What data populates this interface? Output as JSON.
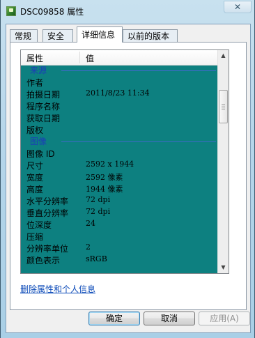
{
  "window": {
    "title": "DSC09858 属性",
    "close_glyph": "✕"
  },
  "tabs": [
    {
      "label": "常规",
      "active": false
    },
    {
      "label": "安全",
      "active": false
    },
    {
      "label": "详细信息",
      "active": true
    },
    {
      "label": "以前的版本",
      "active": false
    }
  ],
  "list": {
    "col_property": "属性",
    "col_value": "值",
    "rows": [
      {
        "type": "group",
        "label": "来源"
      },
      {
        "type": "prop",
        "key": "作者",
        "value": ""
      },
      {
        "type": "prop",
        "key": "拍摄日期",
        "value": "2011/8/23 11:34"
      },
      {
        "type": "prop",
        "key": "程序名称",
        "value": ""
      },
      {
        "type": "prop",
        "key": "获取日期",
        "value": ""
      },
      {
        "type": "prop",
        "key": "版权",
        "value": ""
      },
      {
        "type": "group",
        "label": "图像"
      },
      {
        "type": "prop",
        "key": "图像 ID",
        "value": ""
      },
      {
        "type": "prop",
        "key": "尺寸",
        "value": "2592 x 1944"
      },
      {
        "type": "prop",
        "key": "宽度",
        "value": "2592 像素"
      },
      {
        "type": "prop",
        "key": "高度",
        "value": "1944 像素"
      },
      {
        "type": "prop",
        "key": "水平分辨率",
        "value": "72 dpi"
      },
      {
        "type": "prop",
        "key": "垂直分辨率",
        "value": "72 dpi"
      },
      {
        "type": "prop",
        "key": "位深度",
        "value": "24"
      },
      {
        "type": "prop",
        "key": "压缩",
        "value": ""
      },
      {
        "type": "prop",
        "key": "分辨率单位",
        "value": "2"
      },
      {
        "type": "prop",
        "key": "颜色表示",
        "value": "sRGB"
      }
    ]
  },
  "remove_link": "删除属性和个人信息",
  "buttons": {
    "ok": "确定",
    "cancel": "取消",
    "apply": "应用(A)"
  },
  "colors": {
    "list_background": "#0d8080",
    "group_label": "#1c3cb8",
    "link": "#0a49b8"
  },
  "icons": {
    "window_icon": "image-file-icon",
    "scroll_up": "chevron-up-icon",
    "scroll_down": "chevron-down-icon"
  }
}
